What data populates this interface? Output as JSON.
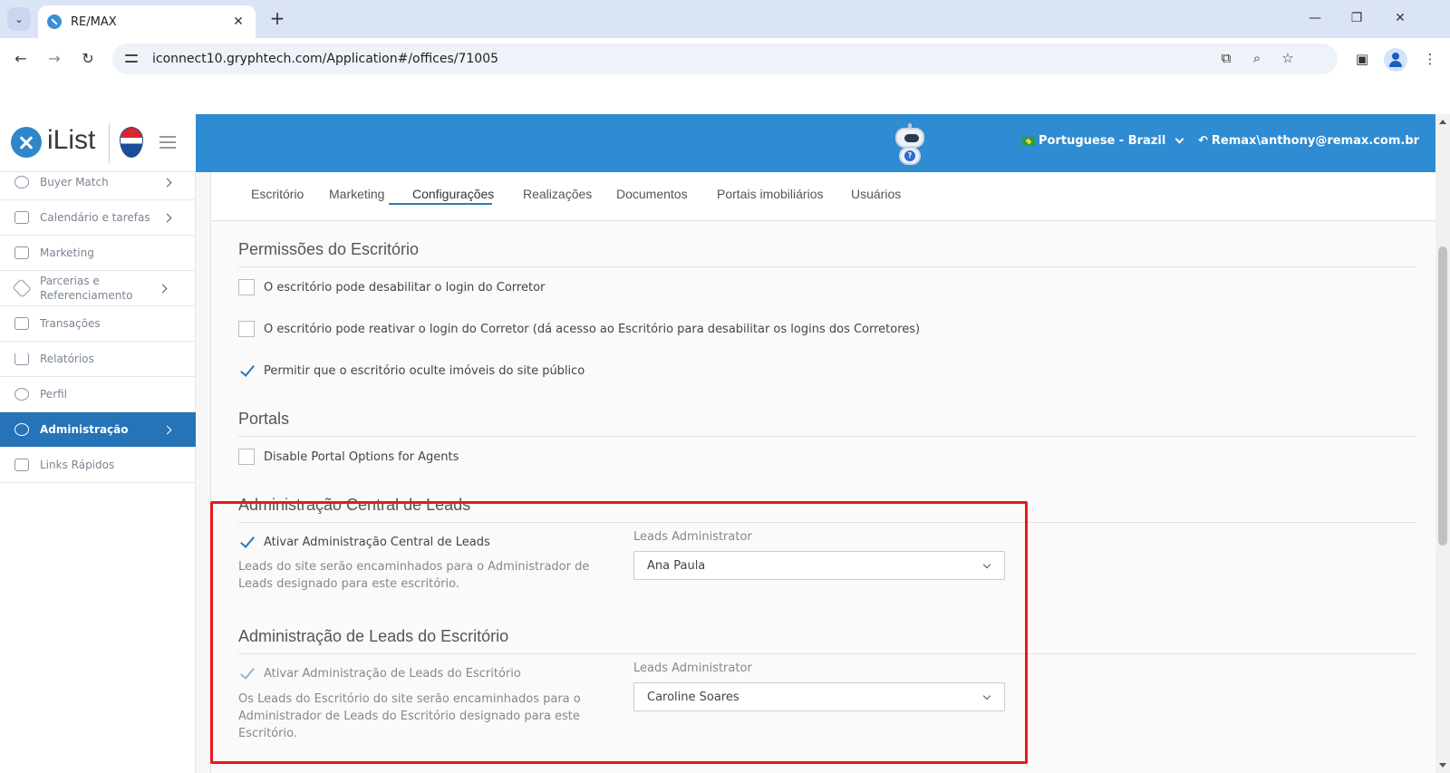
{
  "browser": {
    "tab_title": "RE/MAX",
    "url": "iconnect10.gryphtech.com/Application#/offices/71005"
  },
  "header": {
    "logo_text": "iList",
    "language": "Portuguese - Brazil",
    "user": "Remax\\anthony@remax.com.br"
  },
  "sidebar": {
    "items": [
      {
        "label": "Buyer Match",
        "icon": "user-search-icon",
        "arrow": true
      },
      {
        "label": "Calendário e tarefas",
        "icon": "calendar-icon",
        "arrow": true
      },
      {
        "label": "Marketing",
        "icon": "book-icon",
        "arrow": false
      },
      {
        "label": "Parcerias e Referenciamento",
        "icon": "handshake-icon",
        "arrow": true
      },
      {
        "label": "Transações",
        "icon": "briefcase-icon",
        "arrow": false
      },
      {
        "label": "Relatórios",
        "icon": "bar-chart-icon",
        "arrow": false
      },
      {
        "label": "Perfil",
        "icon": "user-icon",
        "arrow": false
      },
      {
        "label": "Administração",
        "icon": "gear-icon",
        "arrow": true,
        "active": true
      },
      {
        "label": "Links Rápidos",
        "icon": "grid-icon",
        "arrow": false
      }
    ]
  },
  "tabs": [
    "Escritório",
    "Marketing",
    "Configurações",
    "Realizações",
    "Documentos",
    "Portais imobiliários",
    "Usuários"
  ],
  "active_tab": "Configurações",
  "permissions": {
    "title": "Permissões do Escritório",
    "options": [
      {
        "label": "O escritório pode desabilitar o login do Corretor",
        "checked": false
      },
      {
        "label": "O escritório pode reativar o login do Corretor (dá acesso ao Escritório para desabilitar os logins dos Corretores)",
        "checked": false
      },
      {
        "label": "Permitir que o escritório oculte imóveis do site público",
        "checked": true
      }
    ]
  },
  "portals": {
    "title": "Portals",
    "options": [
      {
        "label": "Disable Portal Options for Agents",
        "checked": false
      }
    ]
  },
  "central_leads": {
    "title": "Administração Central de Leads",
    "checkbox_label": "Ativar Administração Central de Leads",
    "checked": true,
    "help": "Leads do site serão encaminhados para o Administrador de Leads designado para este escritório.",
    "field_label": "Leads Administrator",
    "selected": "Ana Paula"
  },
  "office_leads": {
    "title": "Administração de Leads do Escritório",
    "checkbox_label": "Ativar Administração de Leads do Escritório",
    "checked": true,
    "help": "Os Leads do Escritório do site serão encaminhados para o Administrador de Leads do Escritório designado para este Escritório.",
    "field_label": "Leads Administrator",
    "selected": "Caroline Soares"
  },
  "colors": {
    "header_blue": "#2f8cd3",
    "active_sidebar": "#2673b8",
    "highlight_red": "#e8191d"
  }
}
